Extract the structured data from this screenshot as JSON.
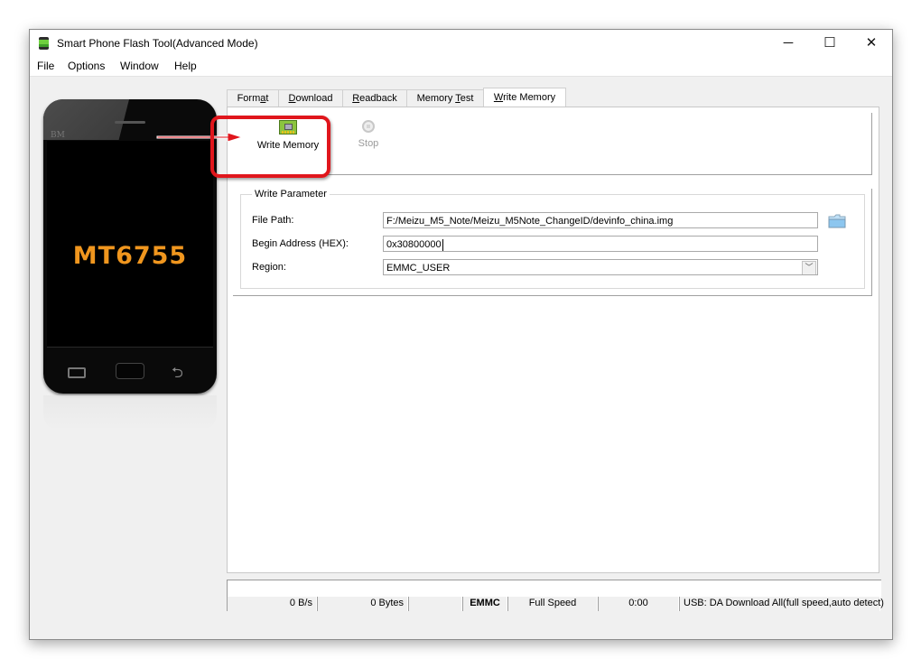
{
  "window": {
    "title": "Smart Phone Flash Tool(Advanced Mode)",
    "controls": {
      "minimize": "─",
      "maximize": "☐",
      "close": "✕"
    }
  },
  "menu": [
    "File",
    "Options",
    "Window",
    "Help"
  ],
  "phone": {
    "brand": "BM",
    "chip": "MT6755"
  },
  "tabs": [
    {
      "label": "Format",
      "underline_index": 4,
      "active": false
    },
    {
      "label": "Download",
      "underline_index": 0,
      "active": false
    },
    {
      "label": "Readback",
      "underline_index": 0,
      "active": false
    },
    {
      "label": "Memory Test",
      "underline_index": 7,
      "active": false
    },
    {
      "label": "Write Memory",
      "underline_index": 0,
      "active": true
    }
  ],
  "toolbar": {
    "write_memory_label": "Write Memory",
    "stop_label": "Stop"
  },
  "write_parameter": {
    "legend": "Write Parameter",
    "file_path_label": "File Path:",
    "file_path_value": "F:/Meizu_M5_Note/Meizu_M5Note_ChangeID/devinfo_china.img",
    "begin_address_label": "Begin Address (HEX):",
    "begin_address_value": "0x30800000",
    "region_label": "Region:",
    "region_value": "EMMC_USER"
  },
  "status_bar": {
    "speed": "0 B/s",
    "bytes": "0 Bytes",
    "empty": "",
    "storage": "EMMC",
    "usb_speed": "Full Speed",
    "time": "0:00",
    "connection": "USB: DA Download All(full speed,auto detect)"
  },
  "progress": {
    "percent": 0
  },
  "colors": {
    "highlight": "#e0161c",
    "chip_label": "#f0961e"
  }
}
